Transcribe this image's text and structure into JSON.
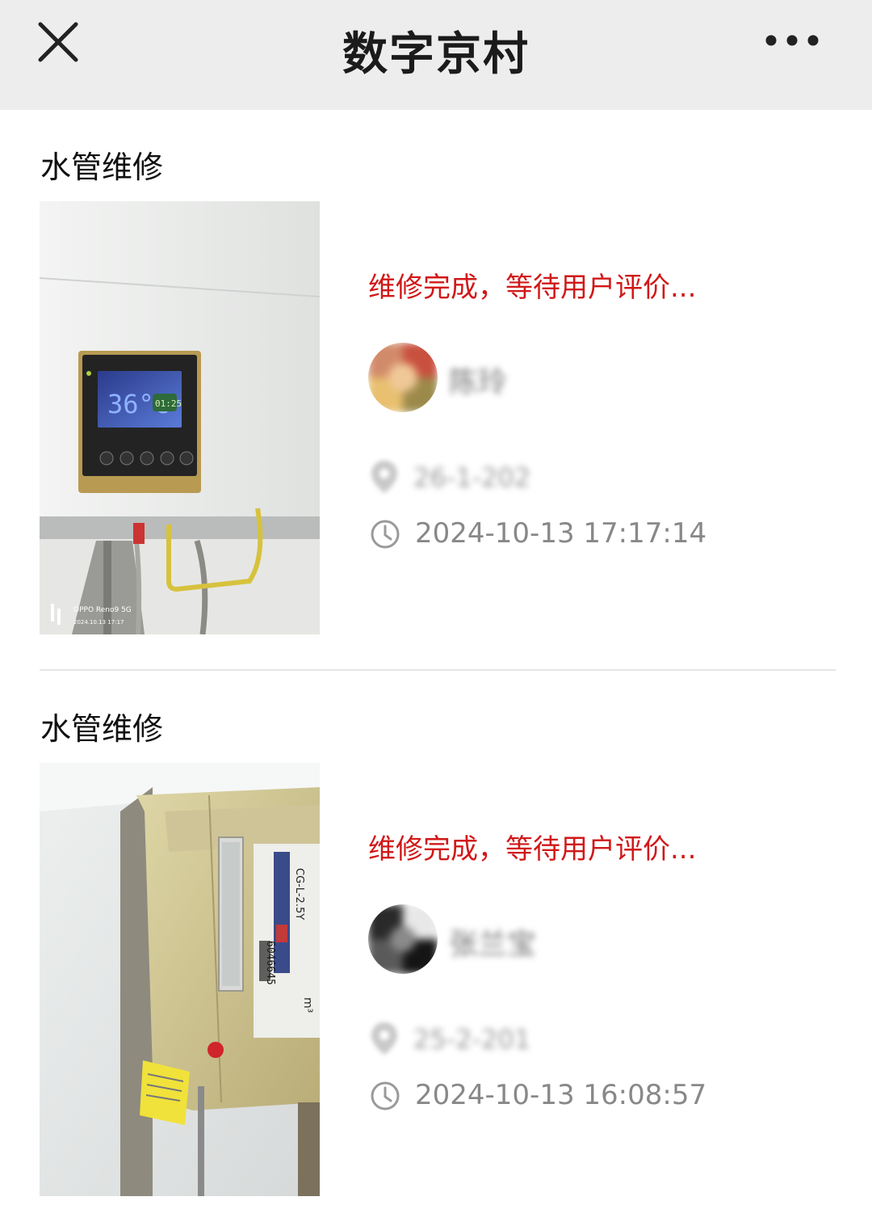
{
  "header": {
    "title": "数字京村",
    "close_icon": "close-icon",
    "more_icon": "more-dots-icon"
  },
  "records": [
    {
      "title": "水管维修",
      "status": "维修完成，等待用户评价...",
      "user_name": "陈玲",
      "address": "26-1-202",
      "time": "2024-10-13 17:17:14",
      "photo_watermark": {
        "device": "OPPO Reno9 5G",
        "stamp": "2024.10.13 17:17"
      },
      "photo_display_temp": "36°c",
      "photo_display_clock": "01:25"
    },
    {
      "title": "水管维修",
      "status": "维修完成，等待用户评价...",
      "user_name": "张兰宝",
      "address": "25-2-201",
      "time": "2024-10-13 16:08:57",
      "photo_meter_model": "CG-L-2.5Y",
      "photo_meter_number": "6046645",
      "photo_meter_unit": "m³"
    }
  ],
  "colors": {
    "status": "#d11818",
    "nav_bg": "#ededed",
    "divider": "#e6e6e6"
  }
}
